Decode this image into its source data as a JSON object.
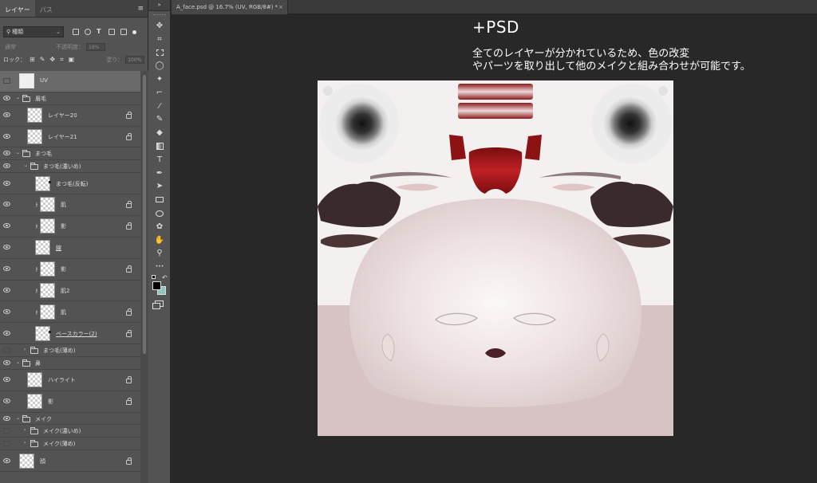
{
  "layers_panel": {
    "tabs": [
      {
        "label": "レイヤー",
        "active": true
      },
      {
        "label": "パス",
        "active": false
      }
    ],
    "menu_glyph": "≡",
    "filter_kind": "種類",
    "blend_mode": "通常",
    "opacity_label": "不透明度：",
    "opacity_value": "18%",
    "lock_label": "ロック：",
    "fill_label": "塗り：",
    "fill_value": "100%",
    "layers": [
      {
        "name": "UV",
        "type": "layer",
        "indent": 0,
        "visible": false,
        "selected": true,
        "thumb": "uv"
      },
      {
        "name": "眉毛",
        "type": "group",
        "indent": 0,
        "visible": true,
        "expanded": true
      },
      {
        "name": "レイヤー20",
        "type": "layer",
        "indent": 1,
        "visible": true,
        "locked": true
      },
      {
        "name": "レイヤー21",
        "type": "layer",
        "indent": 1,
        "visible": true,
        "locked": true
      },
      {
        "name": "まつ毛",
        "type": "group",
        "indent": 0,
        "visible": true,
        "expanded": true
      },
      {
        "name": "まつ毛(濃いめ)",
        "type": "group",
        "indent": 1,
        "visible": true,
        "expanded": true
      },
      {
        "name": "まつ毛(反転)",
        "type": "layer",
        "indent": 2,
        "visible": true,
        "mask": true
      },
      {
        "name": "肌",
        "type": "layer",
        "indent": 2,
        "visible": true,
        "clipped": true,
        "locked": true
      },
      {
        "name": "影",
        "type": "layer",
        "indent": 2,
        "visible": true,
        "clipped": true,
        "locked": true
      },
      {
        "name": "線",
        "type": "layer",
        "indent": 2,
        "visible": true,
        "underline": true
      },
      {
        "name": "影",
        "type": "layer",
        "indent": 2,
        "visible": true,
        "clipped": true,
        "locked": true
      },
      {
        "name": "肌2",
        "type": "layer",
        "indent": 2,
        "visible": true,
        "clipped": true
      },
      {
        "name": "肌",
        "type": "layer",
        "indent": 2,
        "visible": true,
        "clipped": true,
        "locked": true
      },
      {
        "name": "ベースカラー(2)",
        "type": "layer",
        "indent": 2,
        "visible": true,
        "underline": true,
        "mask": true,
        "locked": true
      },
      {
        "name": "まつ毛(薄め)",
        "type": "group",
        "indent": 1,
        "visible": false,
        "expanded": false
      },
      {
        "name": "鼻",
        "type": "group",
        "indent": 0,
        "visible": true,
        "expanded": true
      },
      {
        "name": "ハイライト",
        "type": "layer",
        "indent": 1,
        "visible": true,
        "locked": true
      },
      {
        "name": "影",
        "type": "layer",
        "indent": 1,
        "visible": true,
        "locked": true
      },
      {
        "name": "メイク",
        "type": "group",
        "indent": 0,
        "visible": true,
        "expanded": true
      },
      {
        "name": "メイク(濃いめ)",
        "type": "group",
        "indent": 1,
        "visible": false,
        "expanded": false
      },
      {
        "name": "メイク(薄め)",
        "type": "group",
        "indent": 1,
        "visible": false,
        "expanded": false
      },
      {
        "name": "顔",
        "type": "layer",
        "indent": 0,
        "visible": true,
        "locked": true
      }
    ]
  },
  "tools_panel": {
    "collapse_glyph": "»",
    "tools": [
      {
        "name": "move-tool",
        "glyph": "✥"
      },
      {
        "name": "artboard-tool",
        "glyph": "⌗"
      },
      {
        "name": "marquee-tool",
        "shape": "dsq"
      },
      {
        "name": "lasso-tool",
        "glyph": "◯"
      },
      {
        "name": "magic-wand-tool",
        "glyph": "✦"
      },
      {
        "name": "crop-tool",
        "glyph": "⌐"
      },
      {
        "name": "eyedropper-tool",
        "glyph": "⁄"
      },
      {
        "name": "brush-tool",
        "glyph": "✎"
      },
      {
        "name": "eraser-tool",
        "glyph": "◆"
      },
      {
        "name": "gradient-tool",
        "shape": "grad"
      },
      {
        "name": "type-tool",
        "glyph": "T"
      },
      {
        "name": "pen-tool",
        "glyph": "✒"
      },
      {
        "name": "path-selection-tool",
        "glyph": "➤"
      },
      {
        "name": "rectangle-tool",
        "shape": "rect"
      },
      {
        "name": "ellipse-tool",
        "shape": "ell"
      },
      {
        "name": "custom-shape-tool",
        "glyph": "✿"
      },
      {
        "name": "hand-tool",
        "glyph": "✋"
      },
      {
        "name": "zoom-tool",
        "glyph": "⚲"
      },
      {
        "name": "more-tools",
        "glyph": "•••"
      }
    ],
    "foreground_color": "#000000",
    "background_color": "#8cc6c0"
  },
  "document": {
    "tab_title": "A_face.psd @ 16.7% (UV, RGB/8#) *",
    "close_glyph": "×"
  },
  "annotation": {
    "heading": "+PSD",
    "line1": "全てのレイヤーが分かれているため、色の改変",
    "line2": "やパーツを取り出して他のメイクと組み合わせが可能です。"
  },
  "colors": {
    "texture_bg": "#f5f0f0",
    "skin_light": "#f4eeee",
    "skin_shadow": "#d7c3c4",
    "iris": "#2a2a2a",
    "mouth_red": "#9c1416",
    "lash_dark": "#3b2a2c",
    "lips": "#4a2024"
  }
}
